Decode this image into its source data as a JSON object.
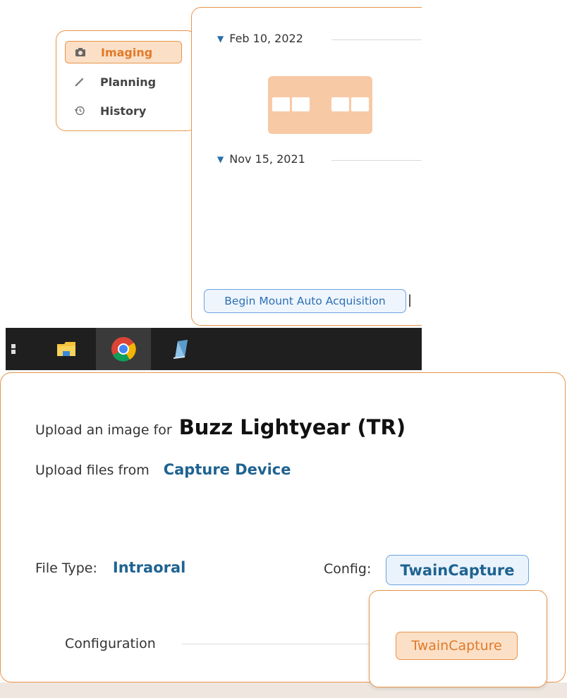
{
  "nav": {
    "items": [
      {
        "label": "Imaging",
        "icon": "camera-icon",
        "active": true
      },
      {
        "label": "Planning",
        "icon": "pencil-icon",
        "active": false
      },
      {
        "label": "History",
        "icon": "history-icon",
        "active": false
      }
    ]
  },
  "timeline": {
    "entries": [
      {
        "date": "Feb 10, 2022"
      },
      {
        "date": "Nov 15, 2021"
      }
    ],
    "begin_button": "Begin Mount Auto Acquisition",
    "separator": "|"
  },
  "taskbar": {
    "icons": [
      "windows-start-icon",
      "file-explorer-icon",
      "chrome-icon",
      "app-icon"
    ]
  },
  "dialog": {
    "upload_prefix": "Upload an image for",
    "patient_name": "Buzz Lightyear (TR)",
    "upload_from_label": "Upload files from",
    "upload_from_value": "Capture Device",
    "file_type_label": "File Type:",
    "file_type_value": "Intraoral",
    "config_label": "Config:",
    "config_value": "TwainCapture",
    "configuration_label": "Configuration",
    "popup_option": "TwainCapture"
  },
  "colors": {
    "accent_orange": "#e8944a",
    "accent_orange_fill": "#fbe0c7",
    "link_blue": "#1f6391",
    "button_blue_border": "#6aa3e0"
  }
}
